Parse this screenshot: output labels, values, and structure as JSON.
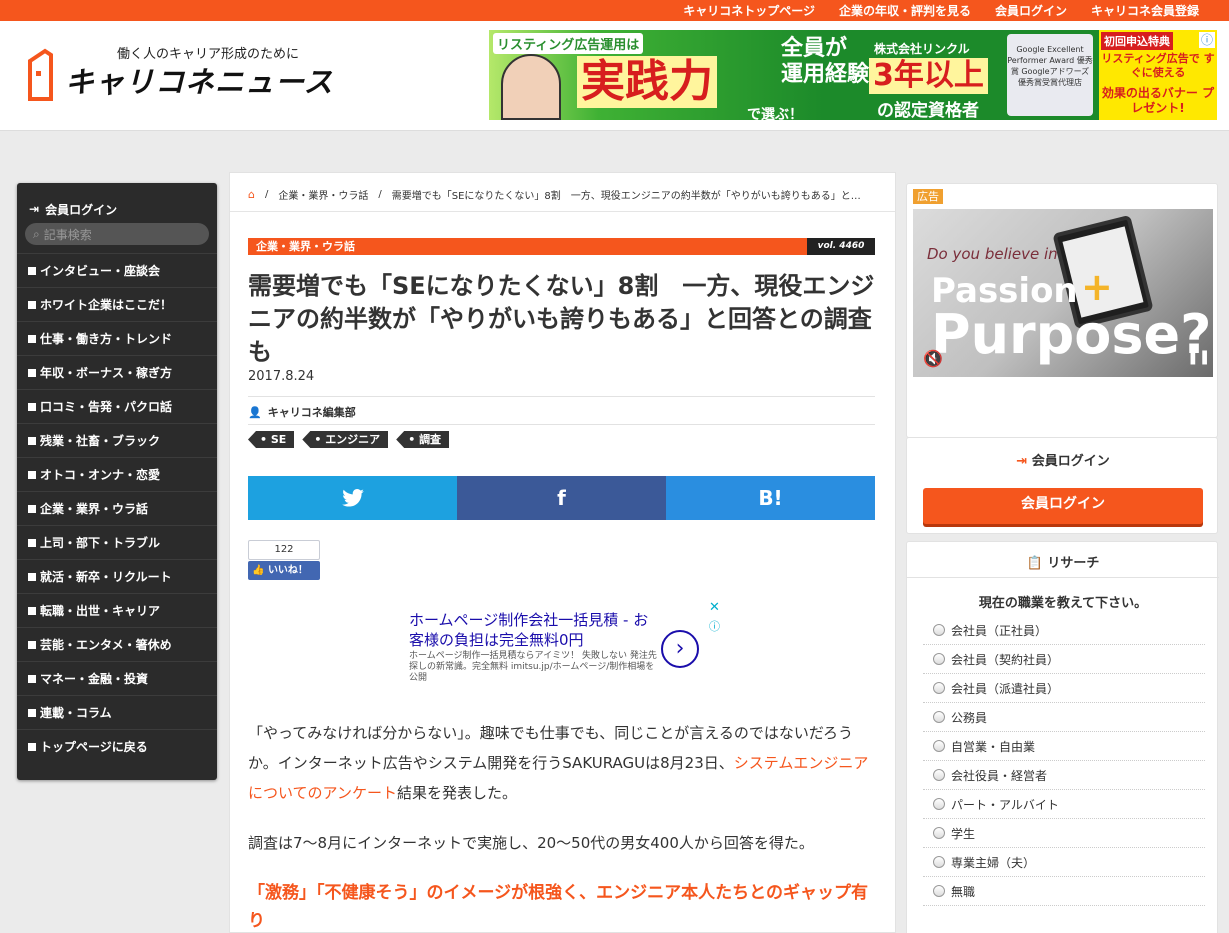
{
  "topnav": [
    "キャリコネトップページ",
    "企業の年収・評判を見る",
    "会員ログイン",
    "キャリコネ会員登録"
  ],
  "header": {
    "tagline": "働く人のキャリア形成のために",
    "logo": "キャリコネニュース"
  },
  "banner": {
    "t1": "リスティング広告運用は",
    "t2": "実践力",
    "t3": "で選ぶ！",
    "t4a": "全員が",
    "t4b": "運用経験",
    "t5": "株式会社リンクル",
    "t6": "3年以上",
    "t7": "の認定資格者",
    "award": "Google Excellent Performer Award 優秀賞 Googleアドワーズ 優秀賞受賞代理店",
    "r1": "初回申込特典",
    "r2": "リスティング広告で すぐに使える",
    "r3": "効果の出るバナー プレゼント!"
  },
  "sidebar": {
    "login": "会員ログイン",
    "search_placeholder": "記事検索",
    "items": [
      "インタビュー・座談会",
      "ホワイト企業はここだ！",
      "仕事・働き方・トレンド",
      "年収・ボーナス・稼ぎ方",
      "口コミ・告発・パクロ話",
      "残業・社畜・ブラック",
      "オトコ・オンナ・恋愛",
      "企業・業界・ウラ話",
      "上司・部下・トラブル",
      "就活・新卒・リクルート",
      "転職・出世・キャリア",
      "芸能・エンタメ・箸休め",
      "マネー・金融・投資",
      "連載・コラム",
      "トップページに戻る"
    ]
  },
  "breadcrumb": [
    "企業・業界・ウラ話",
    "需要増でも「SEになりたくない」8割　一方、現役エンジニアの約半数が「やりがいも誇りもある」と…"
  ],
  "article": {
    "category": "企業・業界・ウラ話",
    "vol": "vol. 4460",
    "title": "需要増でも「SEになりたくない」8割　一方、現役エンジニアの約半数が「やりがいも誇りもある」と回答との調査も",
    "date": "2017.8.24",
    "author": "キャリコネ編集部",
    "tags": [
      "SE",
      "エンジニア",
      "調査"
    ],
    "share": {
      "twitter": "twitter",
      "facebook": "f",
      "hatena": "B!"
    },
    "like_count": "122",
    "like_label": "いいね！",
    "p1a": "「やってみなければ分からない」。趣味でも仕事でも、同じことが言えるのではないだろうか。インターネット広告やシステム開発を行うSAKURAGUは8月23日、",
    "p1link": "システムエンジニアについてのアンケート",
    "p1b": "結果を発表した。",
    "p2": "調査は7～8月にインターネットで実施し、20～50代の男女400人から回答を得た。",
    "h2": "「激務」「不健康そう」のイメージが根強く、エンジニア本人たちとのギャップ有り"
  },
  "text_ad": {
    "title": "ホームページ制作会社一括見積 - お客様の負担は完全無料0円",
    "desc": "ホームページ制作一括見積ならアイミツ！ 失敗しない 発注先探しの新常識。完全無料 imitsu.jp/ホームページ/制作相場を公開",
    "arrow": "›"
  },
  "side_ad": {
    "label": "広告",
    "q": "Do you believe in",
    "p1": "Passion",
    "plus": "+",
    "p2": "Purpose?"
  },
  "login_box": {
    "heading": "会員ログイン",
    "button": "会員ログイン"
  },
  "research": {
    "heading": "リサーチ",
    "question": "現在の職業を教えて下さい。",
    "options": [
      "会社員（正社員）",
      "会社員（契約社員）",
      "会社員（派遣社員）",
      "公務員",
      "自営業・自由業",
      "会社役員・経営者",
      "パート・アルバイト",
      "学生",
      "専業主婦（夫）",
      "無職"
    ]
  },
  "colors": {
    "accent": "#f5561d",
    "twitter": "#1da1e0",
    "facebook": "#3b5998",
    "hatena": "#2a8ee0"
  }
}
